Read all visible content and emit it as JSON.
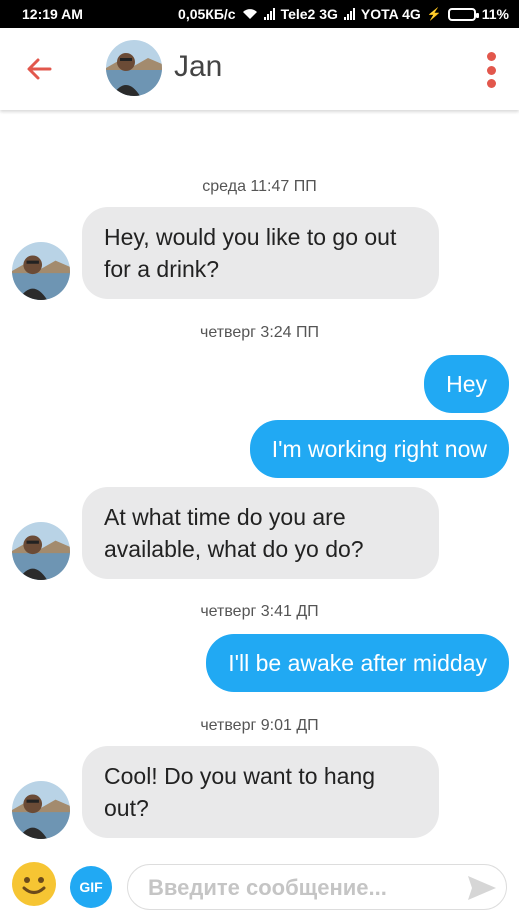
{
  "status_bar": {
    "time": "12:19 AM",
    "speed": "0,05КБ/с",
    "carrier1": "Tele2 3G",
    "carrier2": "YOTA 4G",
    "battery": "11%"
  },
  "header": {
    "contact_name": "Jan",
    "back_icon": "back-arrow-icon",
    "menu_icon": "more-vertical-icon",
    "accent_color": "#e2574c"
  },
  "conversation": [
    {
      "type": "timestamp",
      "text": "среда 11:47 ПП"
    },
    {
      "type": "incoming",
      "text": "Hey, would you like to go out for a drink?"
    },
    {
      "type": "timestamp",
      "text": "четверг 3:24 ПП"
    },
    {
      "type": "outgoing",
      "text": "Hey"
    },
    {
      "type": "outgoing",
      "text": "I'm working right now"
    },
    {
      "type": "incoming",
      "text": "At what time do you are available, what do yo do?"
    },
    {
      "type": "timestamp",
      "text": "четверг 3:41 ДП"
    },
    {
      "type": "outgoing",
      "text": "I'll be awake after midday"
    },
    {
      "type": "timestamp",
      "text": "четверг 9:01 ДП"
    },
    {
      "type": "incoming",
      "text": "Cool! Do you want to hang out?"
    }
  ],
  "composer": {
    "emoji_icon": "emoji-icon",
    "gif_label": "GIF",
    "placeholder": "Введите сообщение...",
    "send_icon": "send-icon"
  },
  "colors": {
    "outgoing_bubble": "#21a9f3",
    "incoming_bubble": "#e9e9ea"
  }
}
